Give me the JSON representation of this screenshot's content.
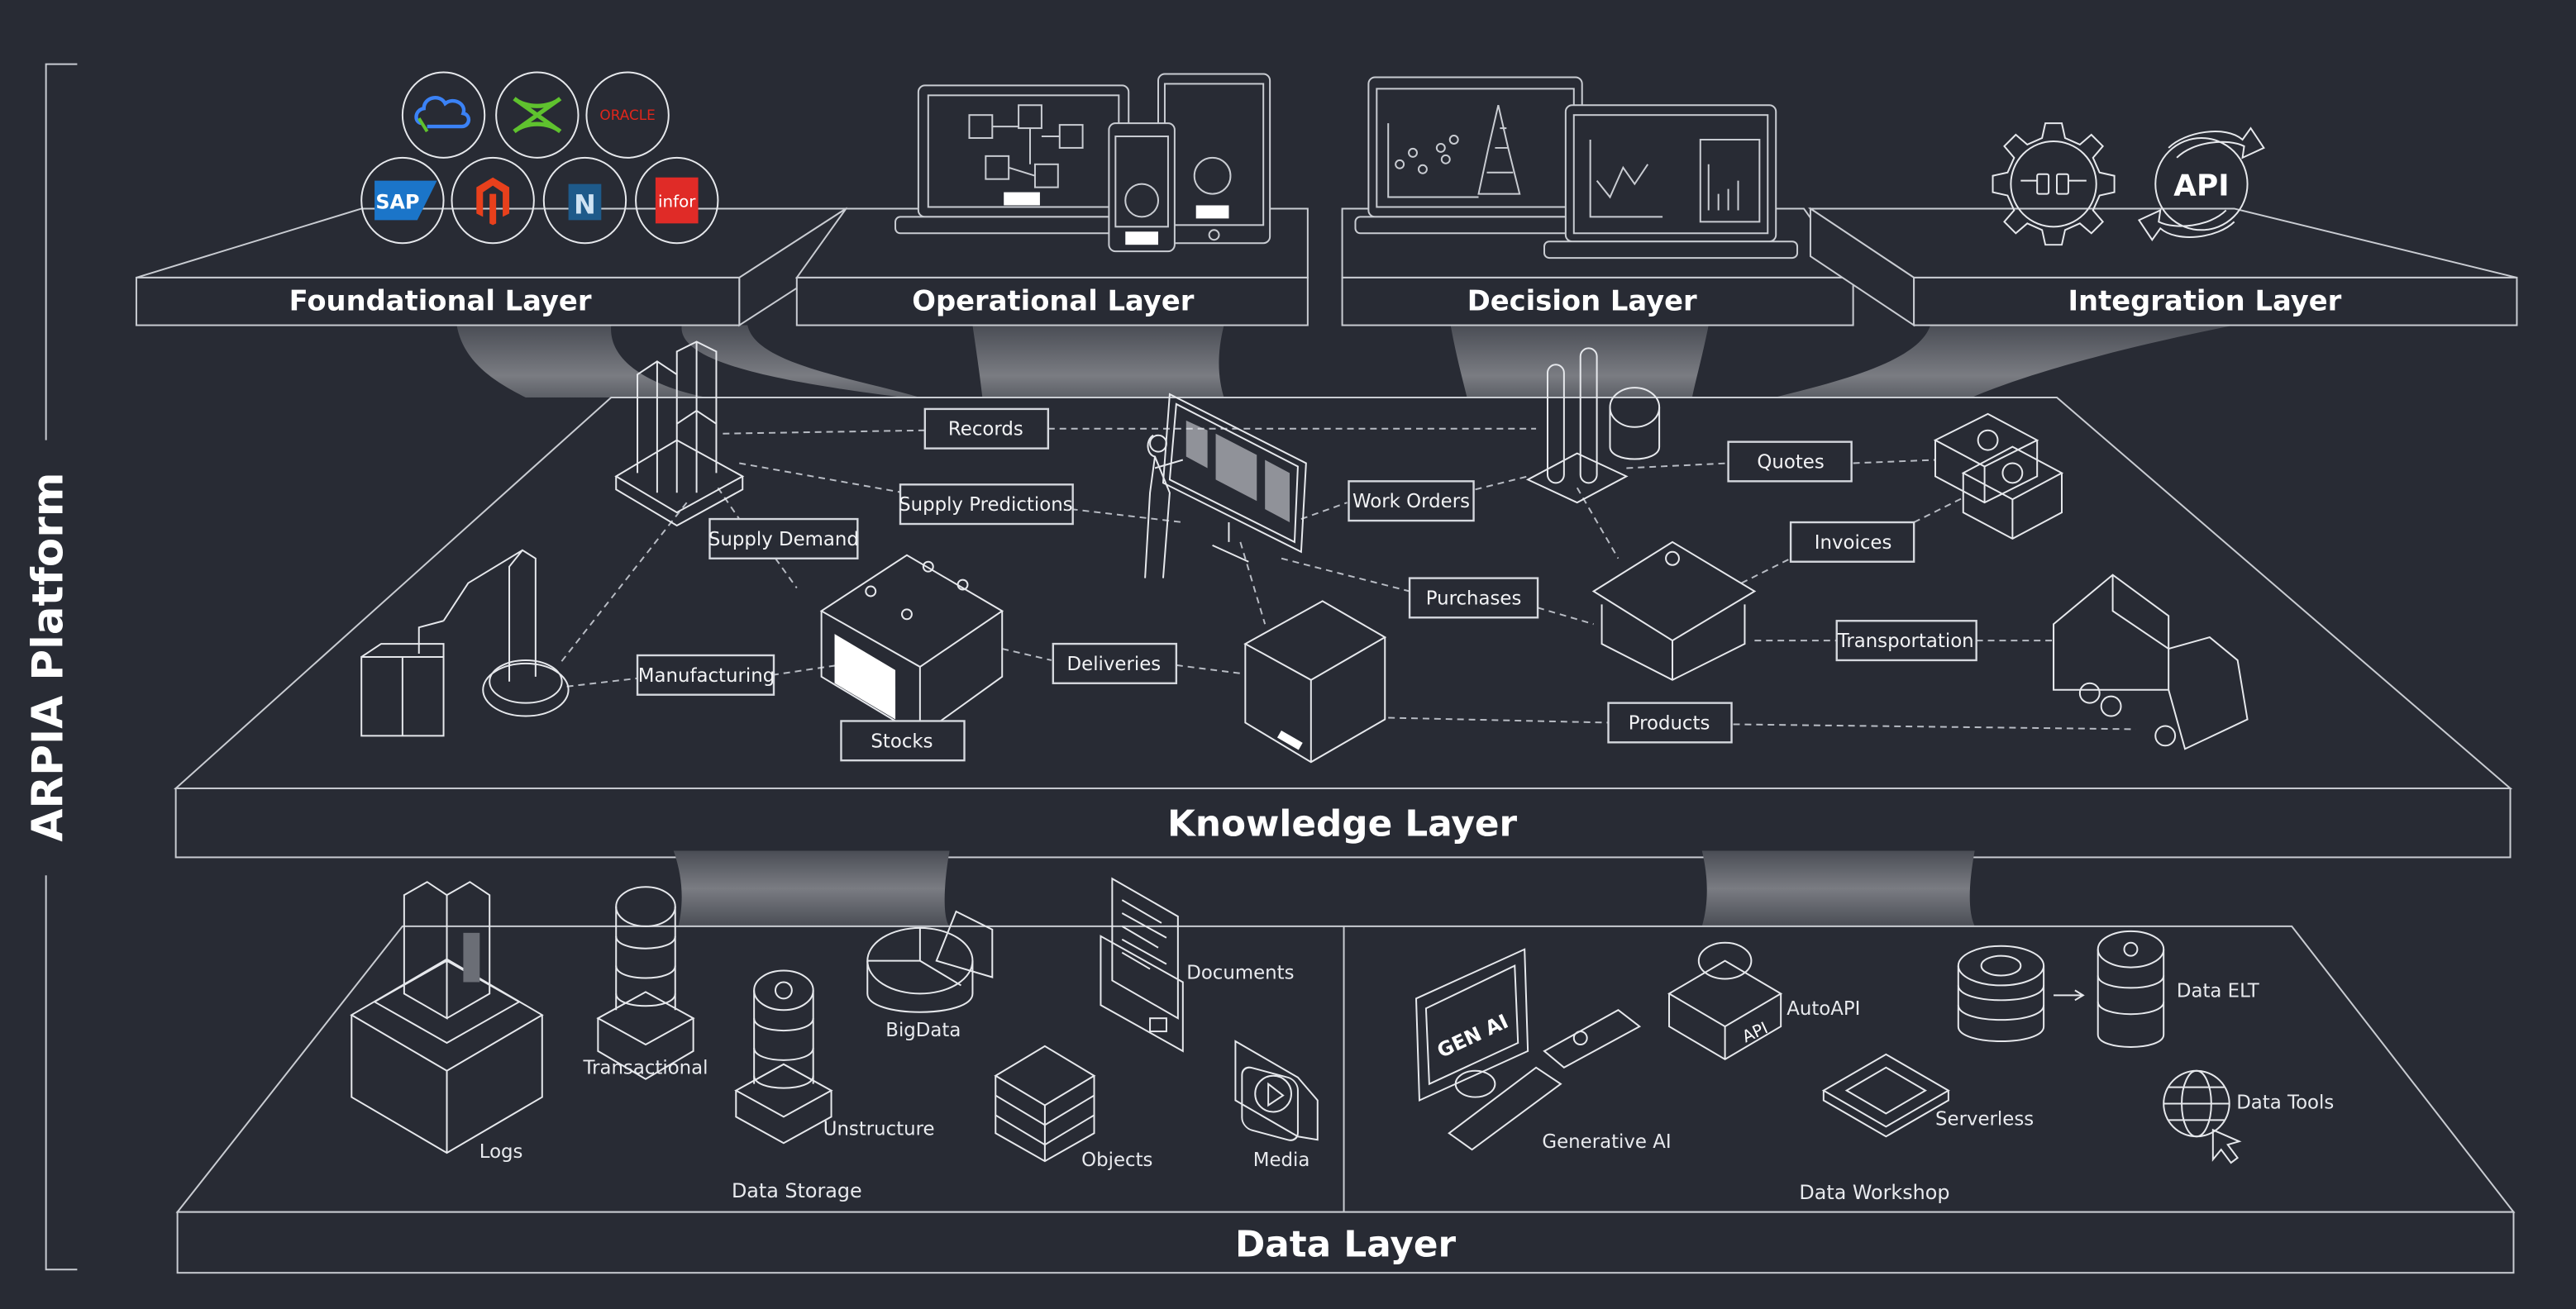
{
  "platform": {
    "title": "ARPIA Platform"
  },
  "colors": {
    "background": "#282b34",
    "line": "#c9ccd2",
    "funnel_top": "#4a4d55",
    "funnel_mid": "#7a7c82",
    "text": "#ffffff"
  },
  "top_layers": [
    {
      "id": "foundational",
      "title": "Foundational Layer",
      "logos": [
        {
          "name": "cloud-logo",
          "label": "",
          "color": "#3b82f6"
        },
        {
          "name": "x-logo",
          "label": "",
          "color": "#5fc22e"
        },
        {
          "name": "oracle-logo",
          "label": "ORACLE",
          "color": "#e0261b"
        },
        {
          "name": "sap-logo",
          "label": "SAP",
          "color": "#1b75c9"
        },
        {
          "name": "magento-logo",
          "label": "",
          "color": "#e8401c"
        },
        {
          "name": "netsuite-logo",
          "label": "N",
          "color": "#1e5a8a"
        },
        {
          "name": "infor-logo",
          "label": "infor",
          "color": "#e02b27"
        }
      ]
    },
    {
      "id": "operational",
      "title": "Operational Layer"
    },
    {
      "id": "decision",
      "title": "Decision Layer"
    },
    {
      "id": "integration",
      "title": "Integration Layer",
      "api_label": "API"
    }
  ],
  "knowledge_layer": {
    "title": "Knowledge Layer",
    "labels": {
      "records": "Records",
      "supply_predictions": "Supply Predictions",
      "supply_demand": "Supply Demand",
      "work_orders": "Work Orders",
      "quotes": "Quotes",
      "invoices": "Invoices",
      "purchases": "Purchases",
      "manufacturing": "Manufacturing",
      "deliveries": "Deliveries",
      "transportation": "Transportation",
      "stocks": "Stocks",
      "products": "Products"
    }
  },
  "data_layer": {
    "title": "Data Layer",
    "storage": {
      "title": "Data Storage",
      "items": {
        "logs": "Logs",
        "transactional": "Transactional",
        "unstructure": "Unstructure",
        "bigdata": "BigData",
        "documents": "Documents",
        "objects": "Objects",
        "media": "Media"
      }
    },
    "workshop": {
      "title": "Data Workshop",
      "gen_ai_screen": "GEN AI",
      "api_badge": "API",
      "items": {
        "generative_ai": "Generative AI",
        "autoapi": "AutoAPI",
        "serverless": "Serverless",
        "data_elt": "Data ELT",
        "data_tools": "Data Tools"
      }
    }
  }
}
